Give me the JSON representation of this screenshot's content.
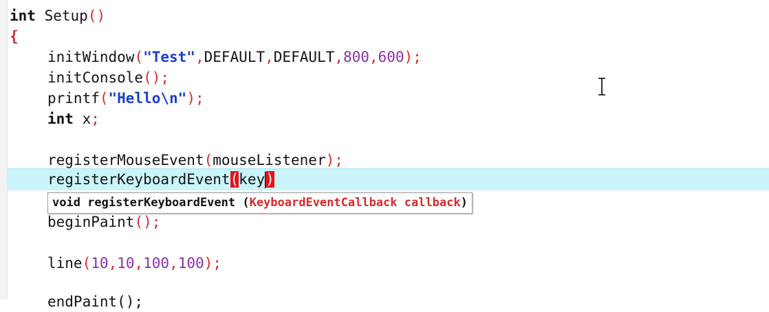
{
  "code": {
    "line1": {
      "kw": "int",
      "name": " Setup",
      "paren": "()"
    },
    "line2": {
      "brace": "{"
    },
    "line3": {
      "fn": "initWindow",
      "open": "(",
      "str": "\"Test\"",
      "c1": ",",
      "a1": "DEFAULT",
      "c2": ",",
      "a2": "DEFAULT",
      "c3": ",",
      "n1": "800",
      "c4": ",",
      "n2": "600",
      "close": ");"
    },
    "line4": {
      "fn": "initConsole",
      "punc": "();"
    },
    "line5": {
      "fn": "printf",
      "open": "(",
      "str": "\"Hello\\n\"",
      "close": ");"
    },
    "line6": {
      "kw": "int",
      "rest": " x",
      "semi": ";"
    },
    "line8": {
      "fn": "registerMouseEvent",
      "open": "(",
      "arg": "mouseListener",
      "close": ");"
    },
    "line9": {
      "fn": "registerKeyboardEvent",
      "open": "(",
      "arg": "key",
      "close": ")"
    },
    "line11": {
      "fn": "beginPaint",
      "punc": "();"
    },
    "line13": {
      "fn": "line",
      "open": "(",
      "n1": "10",
      "c1": ",",
      "n2": "10",
      "c2": ",",
      "n3": "100",
      "c3": ",",
      "n4": "100",
      "close": ");"
    },
    "line15": {
      "partial": "endPaint();"
    }
  },
  "tooltip": {
    "signature_prefix": "void registerKeyboardEvent (",
    "param": "KeyboardEventCallback callback",
    "suffix": ")"
  },
  "colors": {
    "current_line_highlight": "#c9f4fa",
    "brace_match": "#e8131a",
    "string": "#1a3fd0",
    "number": "#8b2fb0",
    "punctuation": "#d62a2a"
  },
  "icons": {
    "cursor": "text-ibeam-cursor"
  }
}
